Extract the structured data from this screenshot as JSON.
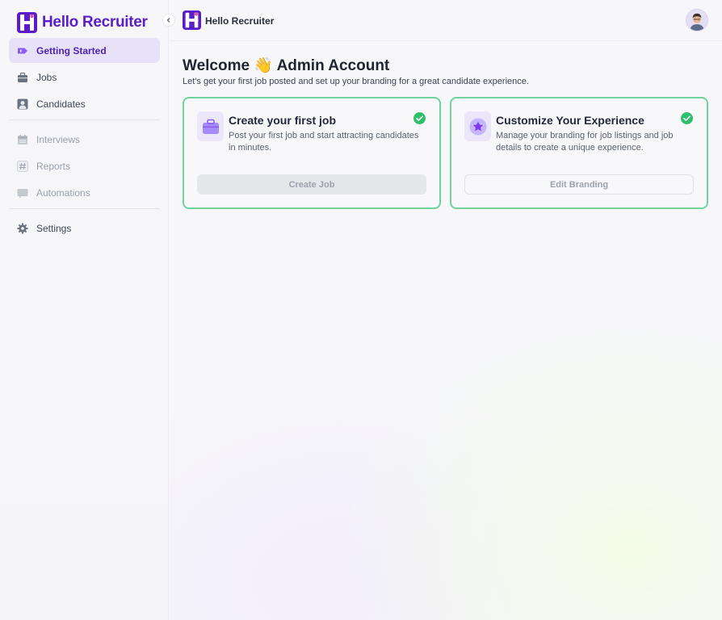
{
  "app": {
    "brand_name": "Hello Recruiter",
    "header_title": "Hello Recruiter",
    "accent_color": "#5b1cc9"
  },
  "sidebar": {
    "items": [
      {
        "label": "Getting Started",
        "icon": "tag-icon",
        "active": true
      },
      {
        "label": "Jobs",
        "icon": "briefcase-icon"
      },
      {
        "label": "Candidates",
        "icon": "person-icon"
      },
      {
        "label": "Interviews",
        "icon": "calendar-icon",
        "disabled": true
      },
      {
        "label": "Reports",
        "icon": "hash-icon",
        "disabled": true
      },
      {
        "label": "Automations",
        "icon": "chat-icon",
        "disabled": true
      },
      {
        "label": "Settings",
        "icon": "gear-icon"
      }
    ]
  },
  "main": {
    "welcome": "Welcome 👋 Admin Account",
    "subtitle": "Let's get your first job posted and set up your branding for a great candidate experience.",
    "cards": [
      {
        "title": "Create your first job",
        "description": "Post your first job and start attracting candidates in minutes.",
        "button": "Create Job",
        "icon": "briefcase-icon",
        "completed": true
      },
      {
        "title": "Customize Your Experience",
        "description": "Manage your branding for job listings and job details to create a unique experience.",
        "button": "Edit Branding",
        "icon": "star-icon",
        "completed": true
      }
    ],
    "success_color": "#2fbf6b"
  }
}
